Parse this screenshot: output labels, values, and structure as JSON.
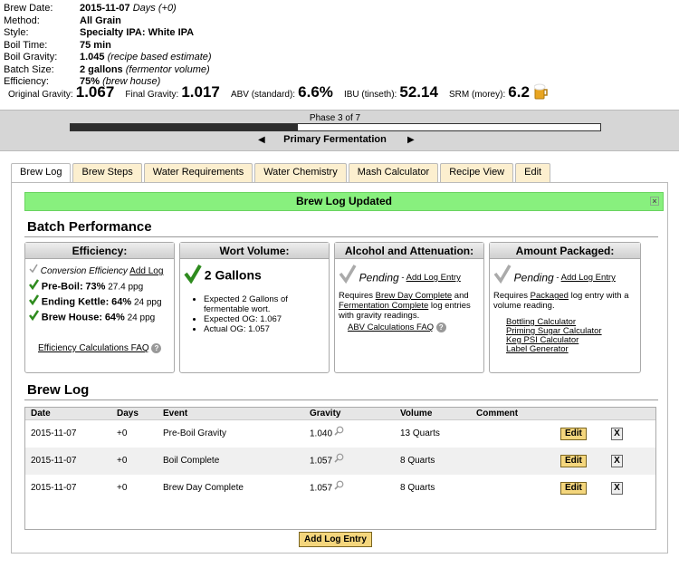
{
  "header": {
    "brew_date_label": "Brew Date:",
    "brew_date": "2015-11-07",
    "brew_date_note": "Days (+0)",
    "method_label": "Method:",
    "method": "All Grain",
    "style_label": "Style:",
    "style": "Specialty IPA: White IPA",
    "boil_time_label": "Boil Time:",
    "boil_time": "75 min",
    "boil_gravity_label": "Boil Gravity:",
    "boil_gravity": "1.045",
    "boil_gravity_note": "(recipe based estimate)",
    "batch_size_label": "Batch Size:",
    "batch_size": "2 gallons",
    "batch_size_note": "(fermentor volume)",
    "efficiency_label": "Efficiency:",
    "efficiency": "75%",
    "efficiency_note": "(brew house)"
  },
  "stats": {
    "og_label": "Original Gravity:",
    "og": "1.067",
    "fg_label": "Final Gravity:",
    "fg": "1.017",
    "abv_label": "ABV (standard):",
    "abv": "6.6%",
    "ibu_label": "IBU (tinseth):",
    "ibu": "52.14",
    "srm_label": "SRM (morey):",
    "srm": "6.2"
  },
  "phase": {
    "text": "Phase 3 of 7",
    "name": "Primary Fermentation",
    "progress": 0.4286,
    "prev": "◀",
    "next": "▶"
  },
  "tabs": [
    "Brew Log",
    "Brew Steps",
    "Water Requirements",
    "Water Chemistry",
    "Mash Calculator",
    "Recipe View",
    "Edit"
  ],
  "notice": {
    "text": "Brew Log Updated",
    "close": "×"
  },
  "batch_performance": {
    "title": "Batch Performance",
    "efficiency": {
      "title": "Efficiency:",
      "conversion_label": "Conversion Efficiency",
      "conversion_link": "Add Log",
      "pre_boil_label": "Pre-Boil:",
      "pre_boil": "73%",
      "pre_boil_ppg": "27.4 ppg",
      "ending_kettle_label": "Ending Kettle:",
      "ending_kettle": "64%",
      "ending_kettle_ppg": "24 ppg",
      "brew_house_label": "Brew House:",
      "brew_house": "64%",
      "brew_house_ppg": "24 ppg",
      "faq": "Efficiency Calculations FAQ"
    },
    "wort_volume": {
      "title": "Wort Volume:",
      "value": "2 Gallons",
      "bullets": [
        "Expected 2 Gallons of fermentable wort.",
        "Expected OG: 1.067",
        "Actual OG: 1.057"
      ]
    },
    "alcohol": {
      "title": "Alcohol and Attenuation:",
      "status": "Pending",
      "link": "Add Log Entry",
      "req_pre": "Requires",
      "req_link1": "Brew Day Complete",
      "req_and": "and",
      "req_link2": "Fermentation Complete",
      "req_post": "log entries with gravity readings.",
      "faq": "ABV Calculations FAQ"
    },
    "packaged": {
      "title": "Amount Packaged:",
      "status": "Pending",
      "link": "Add Log Entry",
      "req_pre": "Requires",
      "req_link": "Packaged",
      "req_post": "log entry with a volume reading.",
      "links": [
        "Bottling Calculator",
        "Priming Sugar Calculator",
        "Keg PSI Calculator",
        "Label Generator"
      ]
    }
  },
  "brew_log": {
    "title": "Brew Log",
    "columns": [
      "Date",
      "Days",
      "Event",
      "Gravity",
      "Volume",
      "Comment"
    ],
    "rows": [
      {
        "date": "2015-11-07",
        "days": "+0",
        "event": "Pre-Boil Gravity",
        "gravity": "1.040",
        "volume": "13 Quarts",
        "comment": ""
      },
      {
        "date": "2015-11-07",
        "days": "+0",
        "event": "Boil Complete",
        "gravity": "1.057",
        "volume": "8 Quarts",
        "comment": ""
      },
      {
        "date": "2015-11-07",
        "days": "+0",
        "event": "Brew Day Complete",
        "gravity": "1.057",
        "volume": "8 Quarts",
        "comment": ""
      }
    ],
    "edit_label": "Edit",
    "delete_label": "X",
    "add_label": "Add Log Entry"
  },
  "colors": {
    "notice_bg": "#88f07e",
    "button_bg": "#f4d67d",
    "tab_bg": "#fcefcf",
    "check_green": "#2e8b1e"
  }
}
